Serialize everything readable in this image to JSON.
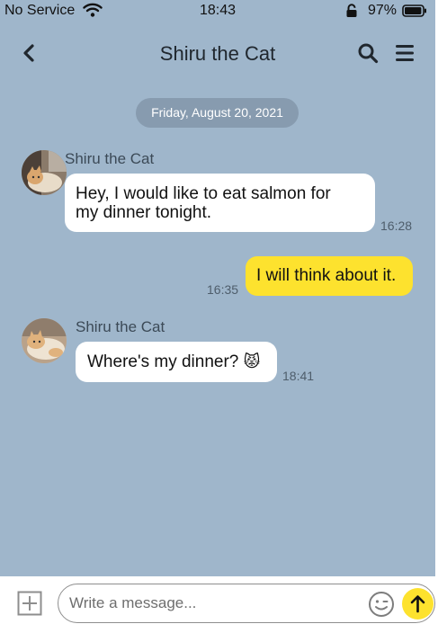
{
  "status_bar": {
    "carrier": "No Service",
    "time": "18:43",
    "battery": "97%",
    "battery_level": 0.97,
    "icons": [
      "wifi-icon",
      "rotation-lock-icon",
      "battery-icon"
    ]
  },
  "header": {
    "title": "Shiru the Cat",
    "icons": [
      "chevron-left-icon",
      "search-icon",
      "menu-icon"
    ]
  },
  "chat": {
    "date": "Friday, August 20, 2021",
    "messages": [
      {
        "direction": "incoming",
        "sender": "Shiru the Cat",
        "lines": [
          "Hey, I would like to eat salmon for",
          "my dinner tonight."
        ],
        "time": "16:28"
      },
      {
        "direction": "outgoing",
        "text": "I will think about it.",
        "time": "16:35"
      },
      {
        "direction": "incoming",
        "sender": "Shiru the Cat",
        "text": "Where's my dinner?",
        "emoji": "😾",
        "time": "18:41"
      }
    ]
  },
  "composer": {
    "placeholder": "Write a message...",
    "value": "",
    "icons": [
      "plus-square-icon",
      "emoji-icon",
      "arrow-up-icon"
    ]
  },
  "colors": {
    "chat_background": "#9fb6cb",
    "date_pill": "#879baf",
    "incoming_bubble": "#ffffff",
    "outgoing_bubble": "#fde22e",
    "send_button": "#fde22e"
  }
}
